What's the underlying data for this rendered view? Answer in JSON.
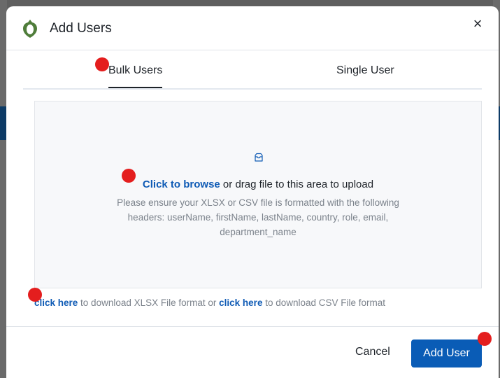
{
  "dialog": {
    "title": "Add Users",
    "close_label": "×"
  },
  "tabs": [
    {
      "label": "Bulk Users",
      "active": true
    },
    {
      "label": "Single User",
      "active": false
    }
  ],
  "upload": {
    "icon": "upload-tray-icon",
    "browse_link": "Click to browse",
    "drag_text": " or drag file to this area to upload",
    "help_text": "Please ensure your XLSX or CSV file is formatted with the following headers: userName, firstName, lastName, country, role, email, department_name"
  },
  "download": {
    "xlsx_link": "click here",
    "xlsx_text": " to download XLSX File format or ",
    "csv_link": "click here",
    "csv_text": " to download CSV File format"
  },
  "footer": {
    "cancel_label": "Cancel",
    "add_label": "Add User"
  },
  "colors": {
    "primary": "#0a5cb6",
    "link": "#0f5bb5",
    "marker": "#e41e1e",
    "logo": "#4f7d3a"
  }
}
